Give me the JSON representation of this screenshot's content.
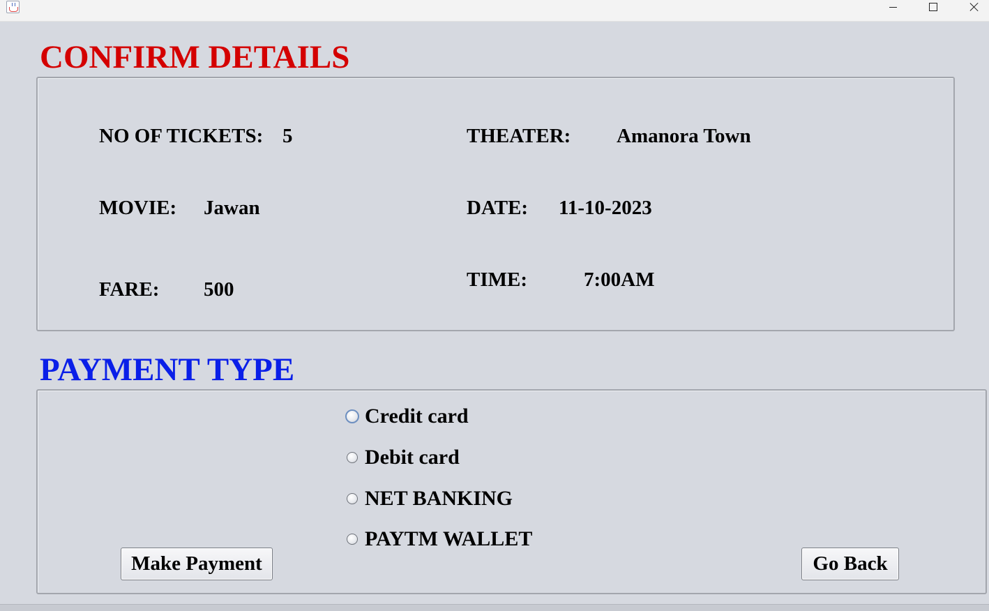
{
  "window": {
    "icon": "java-cup-icon",
    "controls": {
      "minimize": "minimize-icon",
      "maximize": "maximize-icon",
      "close": "close-icon"
    }
  },
  "confirm": {
    "heading": "CONFIRM DETAILS",
    "heading_color": "#d40000",
    "tickets_label": "NO OF TICKETS:",
    "tickets_value": "5",
    "movie_label": "MOVIE:",
    "movie_value": "Jawan",
    "fare_label": "FARE:",
    "fare_value": "500",
    "theater_label": "THEATER:",
    "theater_value": "Amanora Town",
    "date_label": "DATE:",
    "date_value": "11-10-2023",
    "time_label": "TIME:",
    "time_value": "7:00AM"
  },
  "payment": {
    "heading": "PAYMENT TYPE",
    "heading_color": "#0a1fe8",
    "options": [
      {
        "label": "Credit card",
        "selected": false,
        "focused": true
      },
      {
        "label": "Debit card",
        "selected": false,
        "focused": false
      },
      {
        "label": "NET BANKING",
        "selected": false,
        "focused": false
      },
      {
        "label": "PAYTM WALLET",
        "selected": false,
        "focused": false
      }
    ],
    "make_payment_label": "Make Payment",
    "go_back_label": "Go Back"
  }
}
